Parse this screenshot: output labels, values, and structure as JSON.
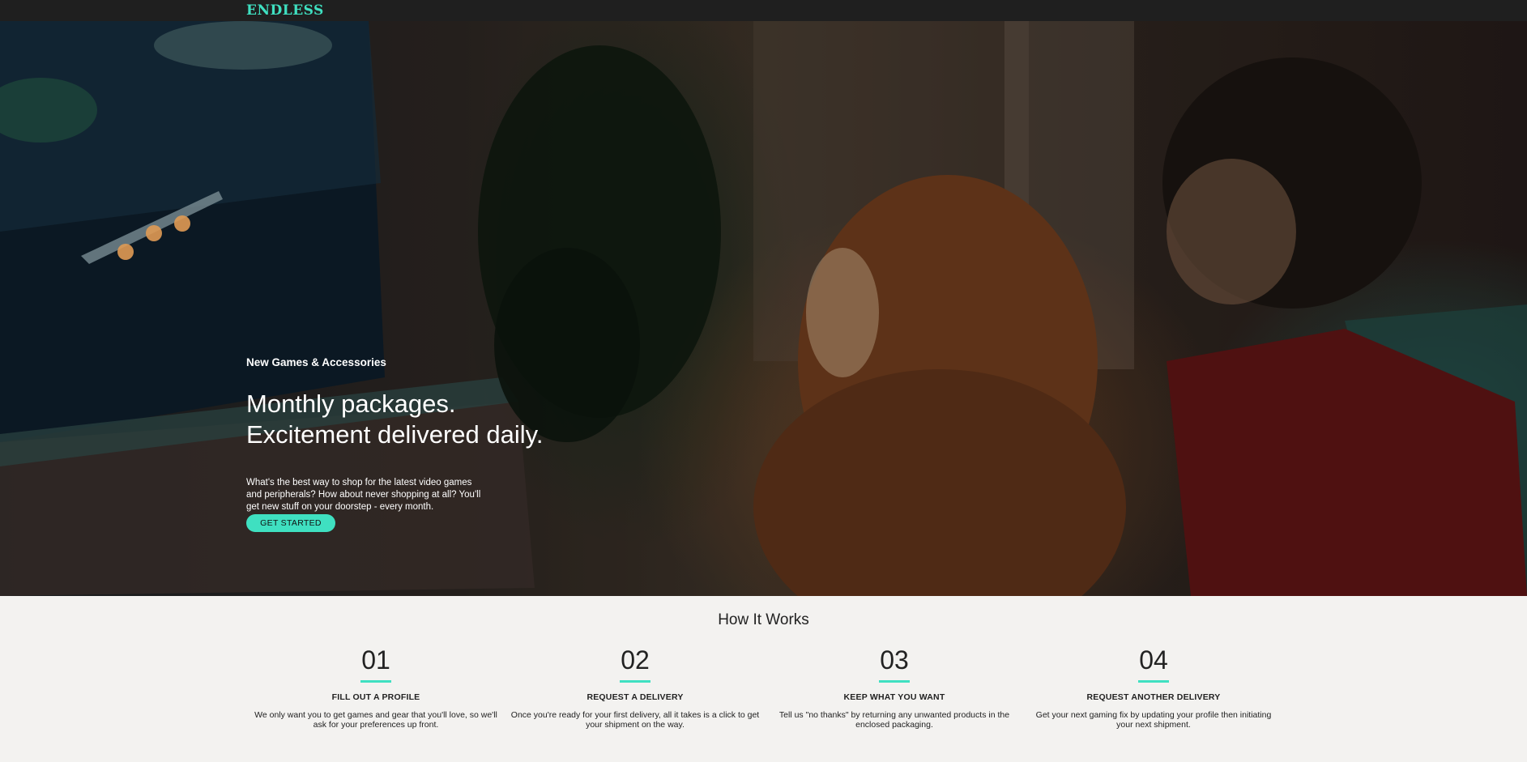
{
  "brand": {
    "logo": "ENDLESS",
    "accent_color": "#3fe0c1",
    "topbar_color": "#1f1f1f"
  },
  "hero": {
    "eyebrow": "New Games & Accessories",
    "headline_line1": "Monthly packages.",
    "headline_line2": "Excitement delivered daily.",
    "description": "What's the best way to shop for the latest video games and peripherals? How about never shopping at all? You'll get new stuff on your doorstep - every month.",
    "cta_label": "GET STARTED"
  },
  "how_it_works": {
    "title": "How It Works",
    "steps": [
      {
        "number": "01",
        "title": "FILL OUT A PROFILE",
        "description": "We only want you to get games and gear that you'll love, so we'll ask for your preferences up front."
      },
      {
        "number": "02",
        "title": "REQUEST A DELIVERY",
        "description": "Once you're ready for your first delivery, all it takes is a click to get your shipment on the way."
      },
      {
        "number": "03",
        "title": "KEEP WHAT YOU WANT",
        "description": "Tell us \"no thanks\" by returning any unwanted products in the enclosed packaging."
      },
      {
        "number": "04",
        "title": "REQUEST ANOTHER DELIVERY",
        "description": "Get your next gaming fix by updating your profile then initiating your next shipment."
      }
    ]
  }
}
